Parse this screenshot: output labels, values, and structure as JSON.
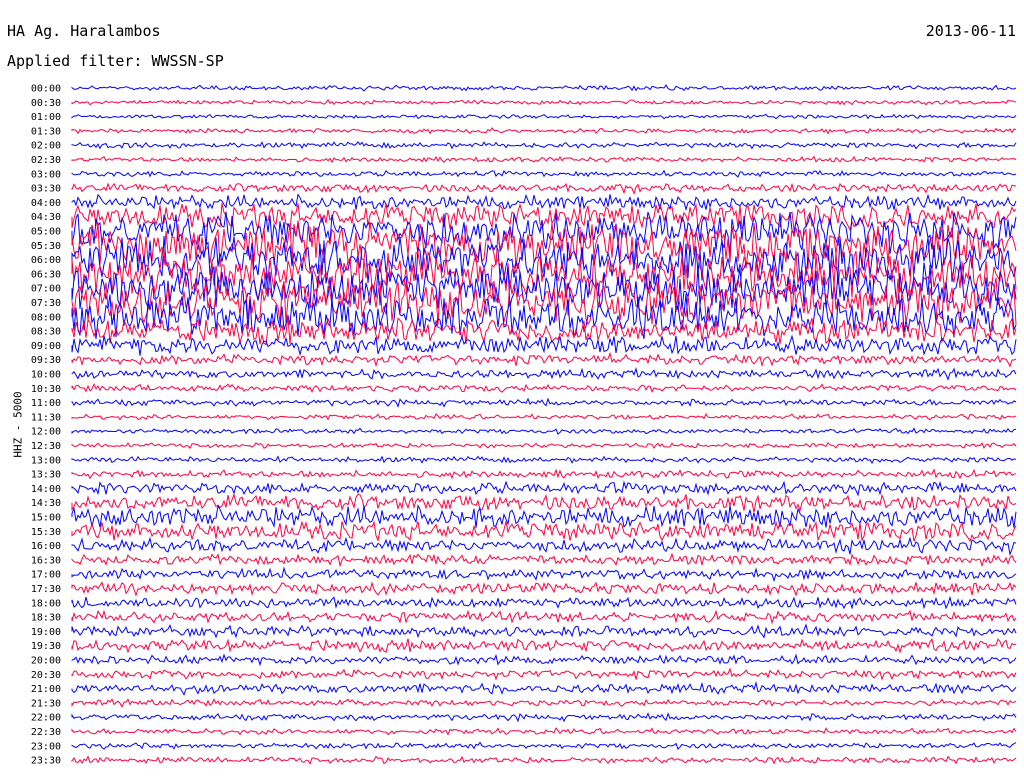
{
  "header": {
    "station": "HA Ag. Haralambos",
    "filter": "Applied filter: WWSSN-SP",
    "date": "2013-06-11"
  },
  "chart_data": {
    "type": "line",
    "title": "HA Ag. Haralambos",
    "subtitle": "Applied filter: WWSSN-SP",
    "ylabel": "HHZ - 5000",
    "colors": {
      "even_rows": "#0000ff",
      "odd_rows": "#ff0040"
    },
    "rows": [
      {
        "label": "00:00",
        "amp": 0.08
      },
      {
        "label": "00:30",
        "amp": 0.06
      },
      {
        "label": "01:00",
        "amp": 0.05
      },
      {
        "label": "01:30",
        "amp": 0.08
      },
      {
        "label": "02:00",
        "amp": 0.1
      },
      {
        "label": "02:30",
        "amp": 0.08
      },
      {
        "label": "03:00",
        "amp": 0.1
      },
      {
        "label": "03:30",
        "amp": 0.18
      },
      {
        "label": "04:00",
        "amp": 0.3
      },
      {
        "label": "04:30",
        "amp": 0.55
      },
      {
        "label": "05:00",
        "amp": 0.85
      },
      {
        "label": "05:30",
        "amp": 1.0
      },
      {
        "label": "06:00",
        "amp": 1.0
      },
      {
        "label": "06:30",
        "amp": 1.0
      },
      {
        "label": "07:00",
        "amp": 1.0
      },
      {
        "label": "07:30",
        "amp": 1.0
      },
      {
        "label": "08:00",
        "amp": 0.9
      },
      {
        "label": "08:30",
        "amp": 0.55
      },
      {
        "label": "09:00",
        "amp": 0.4
      },
      {
        "label": "09:30",
        "amp": 0.22
      },
      {
        "label": "10:00",
        "amp": 0.18
      },
      {
        "label": "10:30",
        "amp": 0.14
      },
      {
        "label": "11:00",
        "amp": 0.12
      },
      {
        "label": "11:30",
        "amp": 0.08
      },
      {
        "label": "12:00",
        "amp": 0.08
      },
      {
        "label": "12:30",
        "amp": 0.08
      },
      {
        "label": "13:00",
        "amp": 0.1
      },
      {
        "label": "13:30",
        "amp": 0.14
      },
      {
        "label": "14:00",
        "amp": 0.25
      },
      {
        "label": "14:30",
        "amp": 0.35
      },
      {
        "label": "15:00",
        "amp": 0.45
      },
      {
        "label": "15:30",
        "amp": 0.4
      },
      {
        "label": "16:00",
        "amp": 0.3
      },
      {
        "label": "16:30",
        "amp": 0.22
      },
      {
        "label": "17:00",
        "amp": 0.22
      },
      {
        "label": "17:30",
        "amp": 0.25
      },
      {
        "label": "18:00",
        "amp": 0.22
      },
      {
        "label": "18:30",
        "amp": 0.22
      },
      {
        "label": "19:00",
        "amp": 0.22
      },
      {
        "label": "19:30",
        "amp": 0.25
      },
      {
        "label": "20:00",
        "amp": 0.18
      },
      {
        "label": "20:30",
        "amp": 0.18
      },
      {
        "label": "21:00",
        "amp": 0.2
      },
      {
        "label": "21:30",
        "amp": 0.12
      },
      {
        "label": "22:00",
        "amp": 0.12
      },
      {
        "label": "22:30",
        "amp": 0.1
      },
      {
        "label": "23:00",
        "amp": 0.1
      },
      {
        "label": "23:30",
        "amp": 0.12
      }
    ]
  }
}
